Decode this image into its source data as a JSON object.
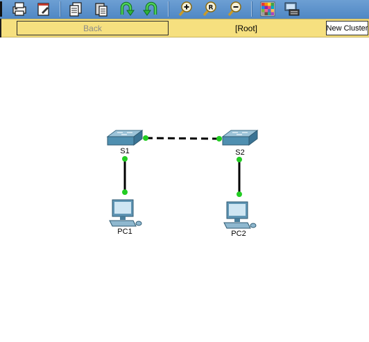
{
  "toolbar": {
    "icons": [
      "print-icon",
      "edit-icon",
      "copy-icon",
      "paste-icon",
      "undo-icon",
      "redo-icon",
      "zoom-in-icon",
      "zoom-reset-icon",
      "zoom-out-icon",
      "palette-icon",
      "custom-device-icon"
    ]
  },
  "navbar": {
    "back_label": "Back",
    "cluster_label": "[Root]",
    "new_cluster_label": "New Cluster"
  },
  "topology": {
    "devices": [
      {
        "id": "s1",
        "label": "S1",
        "type": "switch"
      },
      {
        "id": "s2",
        "label": "S2",
        "type": "switch"
      },
      {
        "id": "pc1",
        "label": "PC1",
        "type": "pc"
      },
      {
        "id": "pc2",
        "label": "PC2",
        "type": "pc"
      }
    ],
    "links": [
      {
        "from": "S1",
        "to": "S2",
        "style": "crossover-dashed"
      },
      {
        "from": "S1",
        "to": "PC1",
        "style": "straight"
      },
      {
        "from": "S2",
        "to": "PC2",
        "style": "straight"
      }
    ],
    "link_status_color": "#22cc22",
    "cable_color": "#000000"
  }
}
